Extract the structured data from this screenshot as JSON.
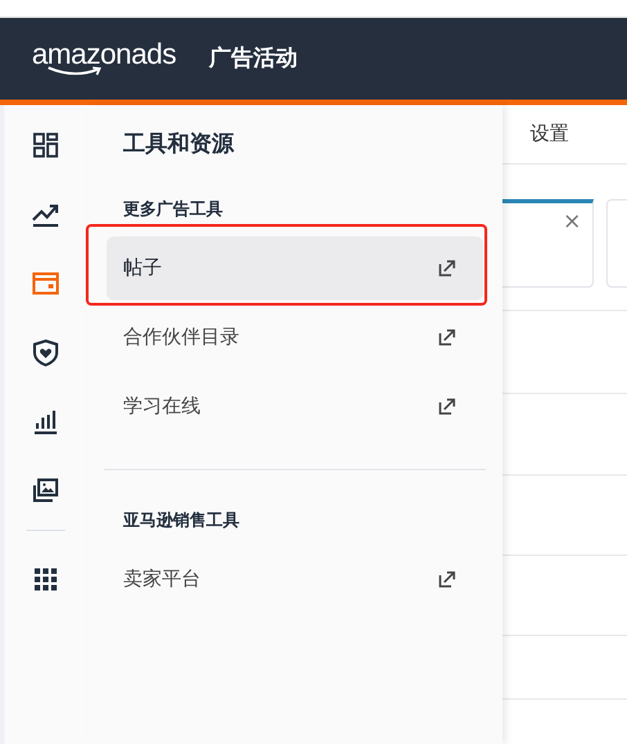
{
  "header": {
    "logo": "amazonads",
    "title": "广告活动"
  },
  "sidebar": {
    "items": [
      {
        "kind": "dashboard",
        "selected": false
      },
      {
        "kind": "trend",
        "selected": false
      },
      {
        "kind": "wallet",
        "selected": true
      },
      {
        "kind": "shield",
        "selected": false
      },
      {
        "kind": "bars",
        "selected": false
      },
      {
        "kind": "gallery",
        "selected": false
      },
      {
        "kind": "apps",
        "selected": false
      }
    ]
  },
  "background": {
    "tabs": [
      {
        "label": "设置"
      }
    ],
    "chip": {
      "close": "×"
    }
  },
  "flyout": {
    "title": "工具和资源",
    "sections": [
      {
        "heading": "更多广告工具",
        "items": [
          {
            "label": "帖子",
            "selected": true,
            "highlighted": true
          },
          {
            "label": "合作伙伴目录",
            "selected": false,
            "highlighted": false
          },
          {
            "label": "学习在线",
            "selected": false,
            "highlighted": false
          }
        ]
      },
      {
        "heading": "亚马逊销售工具",
        "items": [
          {
            "label": "卖家平台",
            "selected": false,
            "highlighted": false
          }
        ]
      }
    ]
  }
}
